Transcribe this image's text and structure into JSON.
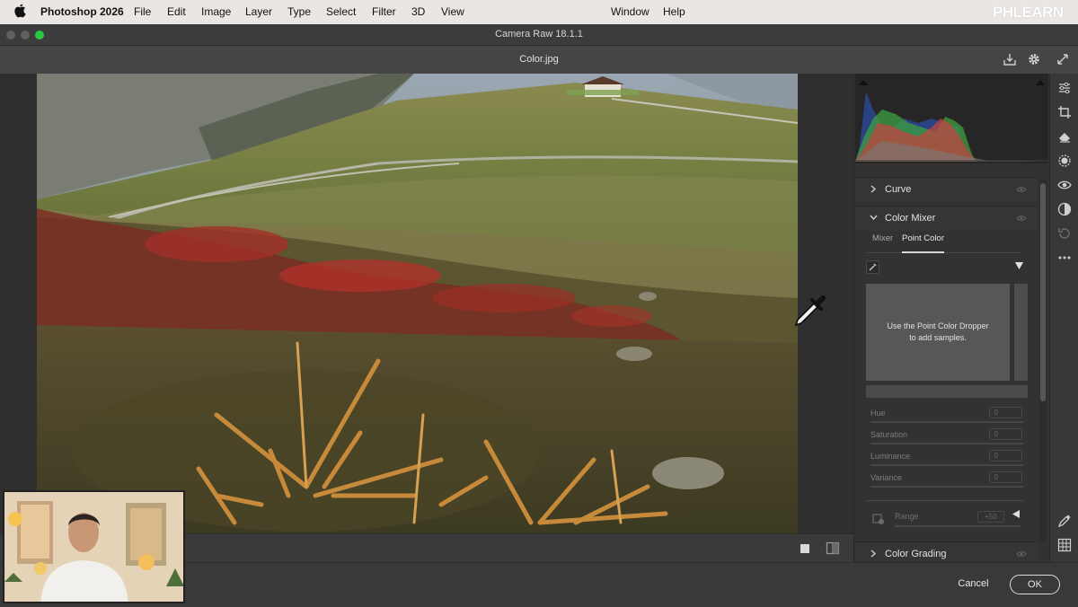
{
  "menubar": {
    "app_name": "Photoshop 2026",
    "items": [
      "File",
      "Edit",
      "Image",
      "Layer",
      "Type",
      "Select",
      "Filter",
      "3D",
      "View",
      "Window",
      "Help"
    ],
    "brand": "PHLEARN"
  },
  "window": {
    "title": "Camera Raw 18.1.1"
  },
  "file": {
    "name": "Color.jpg"
  },
  "panel": {
    "sections": {
      "curve": "Curve",
      "color_mixer": "Color Mixer",
      "color_grading": "Color Grading"
    },
    "color_mixer": {
      "tabs": [
        "Mixer",
        "Point Color"
      ],
      "active_tab": "Point Color",
      "empty_message_line1": "Use the Point Color Dropper",
      "empty_message_line2": "to add samples.",
      "sliders": [
        {
          "label": "Hue",
          "value": "0"
        },
        {
          "label": "Saturation",
          "value": "0"
        },
        {
          "label": "Luminance",
          "value": "0"
        },
        {
          "label": "Variance",
          "value": "0"
        }
      ],
      "range": {
        "label": "Range",
        "value": "+50"
      }
    }
  },
  "footer": {
    "cancel": "Cancel",
    "ok": "OK"
  },
  "icons": {
    "save": "download-icon",
    "settings": "gear-icon",
    "fullscreen": "expand-icon",
    "edit": "sliders-icon",
    "crop": "crop-icon",
    "heal": "eraser-icon",
    "mask": "mask-icon",
    "redeye": "eye-icon",
    "presets": "presets-icon",
    "snapshots": "snapshots-icon",
    "more": "more-icon",
    "sampler": "eyedropper-icon",
    "grid": "grid-icon"
  },
  "colors": {
    "accent": "#4a9eff",
    "histogram_red": "#d9483f",
    "histogram_green": "#4fbf4a",
    "histogram_blue": "#3a6fd8"
  }
}
